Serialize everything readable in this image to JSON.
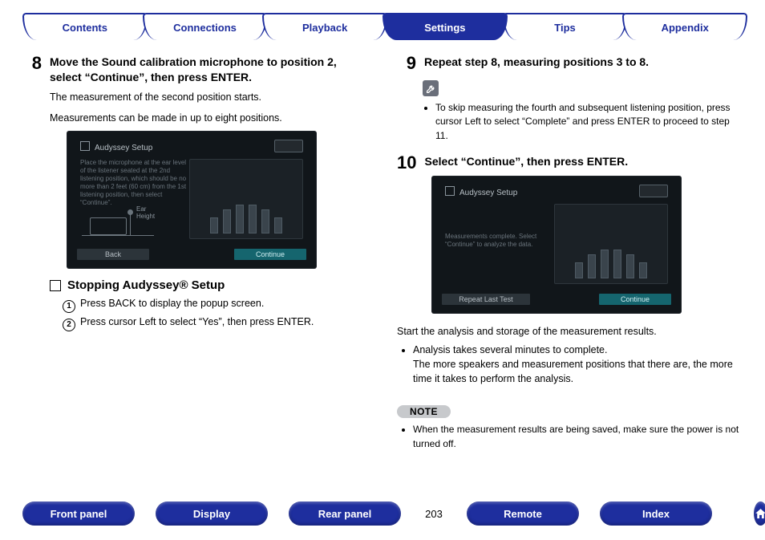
{
  "tabs": {
    "items": [
      "Contents",
      "Connections",
      "Playback",
      "Settings",
      "Tips",
      "Appendix"
    ],
    "active_index": 3
  },
  "step8": {
    "num": "8",
    "head": "Move the Sound calibration microphone to position 2, select “Continue”, then press ENTER.",
    "body1": "The measurement of the second position starts.",
    "body2": "Measurements can be made in up to eight positions."
  },
  "shot8": {
    "title": "Audyssey Setup",
    "blurb": "Place the microphone at the ear level of the listener seated at the 2nd listening position, which should be no more than 2 feet (60 cm) from the 1st listening position, then select “Continue”.",
    "ear_label": "Ear Height",
    "btn_left": "Back",
    "btn_right": "Continue"
  },
  "stopping": {
    "head": "Stopping Audyssey® Setup",
    "item1_num": "1",
    "item1_text": "Press BACK to display the popup screen.",
    "item2_num": "2",
    "item2_text": "Press cursor Left to select “Yes”, then press ENTER."
  },
  "step9": {
    "num": "9",
    "head": "Repeat step 8, measuring positions 3 to 8.",
    "wrench_tip": "To skip measuring the fourth and subsequent listening position, press cursor Left to select “Complete” and press ENTER to proceed to step 11."
  },
  "step10": {
    "num": "10",
    "head": "Select “Continue”, then press ENTER."
  },
  "shot10": {
    "title": "Audyssey Setup",
    "blurb": "Measurements complete. Select “Continue” to analyze the data.",
    "btn_left": "Repeat Last Test",
    "btn_right": "Continue"
  },
  "analysis": {
    "lead": "Start the analysis and storage of the measurement results.",
    "bullet1": "Analysis takes several minutes to complete.",
    "bullet1b": "The more speakers and measurement positions that there are, the more time it takes to perform the analysis."
  },
  "note": {
    "label": "NOTE",
    "bullet": "When the measurement results are being saved, make sure the power is not turned off."
  },
  "bottom": {
    "items": [
      "Front panel",
      "Display",
      "Rear panel"
    ],
    "page": "203",
    "items2": [
      "Remote",
      "Index"
    ]
  },
  "icons": {
    "home": "home-icon",
    "prev": "arrow-left-icon",
    "next": "arrow-right-icon",
    "wrench": "wrench-icon"
  }
}
